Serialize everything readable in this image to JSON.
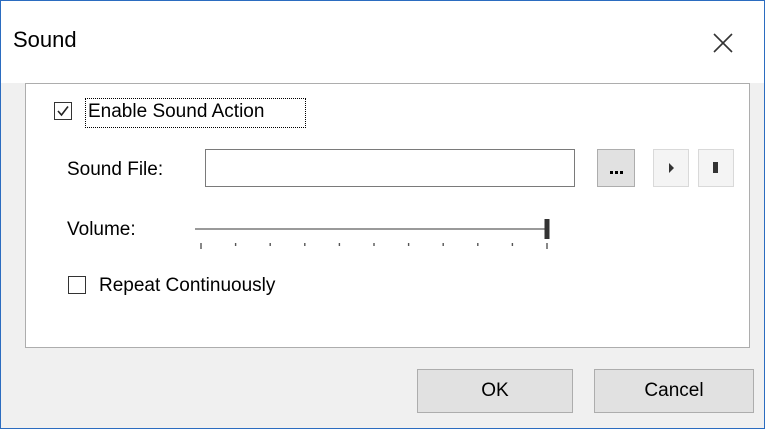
{
  "window": {
    "title": "Sound"
  },
  "icons": {
    "close": "close-icon",
    "browse": "ellipsis-icon",
    "play": "play-icon",
    "stop": "stop-icon",
    "check": "checkmark-icon"
  },
  "sound_action": {
    "enable_label": "Enable Sound Action",
    "enable_checked": true,
    "sound_file_label": "Sound File:",
    "sound_file_value": "",
    "browse_label": "...",
    "volume_label": "Volume:",
    "volume_value": 1.0,
    "volume_tick_count": 11,
    "repeat_label": "Repeat Continuously",
    "repeat_checked": false
  },
  "buttons": {
    "ok": "OK",
    "cancel": "Cancel"
  },
  "colors": {
    "window_border": "#2b6cc0",
    "button_face": "#e1e1e1",
    "panel_bg": "#ffffff",
    "dialog_bg": "#f0f0f0"
  }
}
